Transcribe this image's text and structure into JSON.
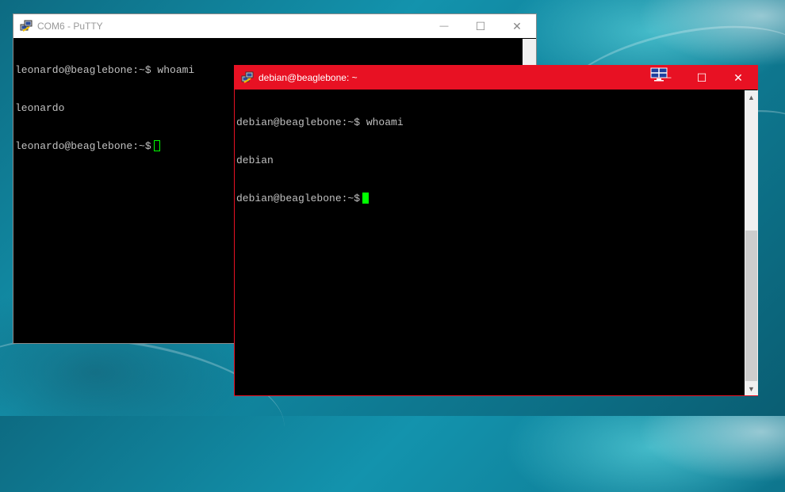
{
  "colors": {
    "active_titlebar": "#e81123",
    "inactive_titlebar": "#ffffff",
    "terminal_bg": "#000000",
    "terminal_text": "#c0c0c0",
    "cursor": "#00ff00"
  },
  "back_window": {
    "title": "COM6 - PuTTY",
    "icon": "putty-icon",
    "controls": {
      "minimize": "—",
      "maximize": "☐",
      "close": "✕"
    },
    "lines": [
      "leonardo@beaglebone:~$ whoami",
      "leonardo",
      "leonardo@beaglebone:~$"
    ]
  },
  "front_window": {
    "title": "debian@beaglebone: ~",
    "icon": "putty-icon",
    "extra_icon": "network-monitor-icon",
    "controls": {
      "minimize": "—",
      "maximize": "☐",
      "close": "✕"
    },
    "lines": [
      "debian@beaglebone:~$ whoami",
      "debian",
      "debian@beaglebone:~$"
    ],
    "scrollbar": {
      "up_arrow": "▲",
      "down_arrow": "▼"
    }
  }
}
